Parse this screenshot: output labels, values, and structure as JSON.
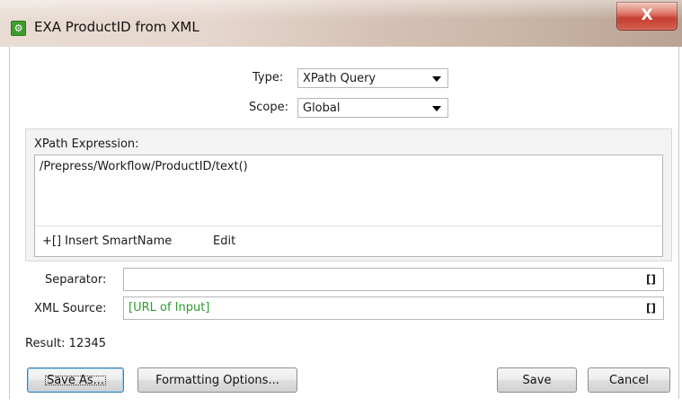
{
  "window": {
    "title": "EXA ProductID from XML",
    "close_label": "X"
  },
  "form": {
    "type_label": "Type:",
    "type_value": "XPath Query",
    "scope_label": "Scope:",
    "scope_value": "Global",
    "xpath_label": "XPath Expression:",
    "xpath_value": "/Prepress/Workflow/ProductID/text()",
    "insert_smartname": "+[] Insert SmartName",
    "edit": "Edit",
    "separator_label": "Separator:",
    "separator_value": "",
    "xml_source_label": "XML Source:",
    "xml_source_value": "[URL of Input]",
    "smartname_icon_glyph": "[]",
    "result_label": "Result: 12345"
  },
  "buttons": {
    "save_as": "Save As...",
    "formatting": "Formatting Options...",
    "save": "Save",
    "cancel": "Cancel"
  },
  "colors": {
    "smartname_text": "#2e9a2e",
    "app_icon": "#3f9d2f",
    "close_button": "#c9473a"
  }
}
